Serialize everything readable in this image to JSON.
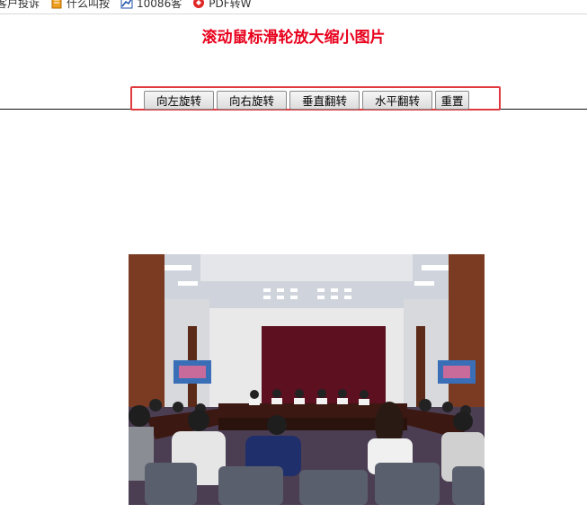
{
  "bookmarks": [
    {
      "label": "客户投诉",
      "icon": "bookmark-icon"
    },
    {
      "label": "什么叫按",
      "icon": "notebook-icon"
    },
    {
      "label": "10086客",
      "icon": "chart-icon"
    },
    {
      "label": "PDF转W",
      "icon": "pdf-icon"
    }
  ],
  "page": {
    "title": "滚动鼠标滑轮放大缩小图片"
  },
  "toolbar": {
    "rotate_left": "向左旋转",
    "rotate_right": "向右旋转",
    "flip_vertical": "垂直翻转",
    "flip_horizontal": "水平翻转",
    "reset": "重置"
  },
  "colors": {
    "title": "#e8001c",
    "toolbar_border": "#e0393e"
  },
  "image": {
    "subject": "conference-room-meeting-photo"
  }
}
